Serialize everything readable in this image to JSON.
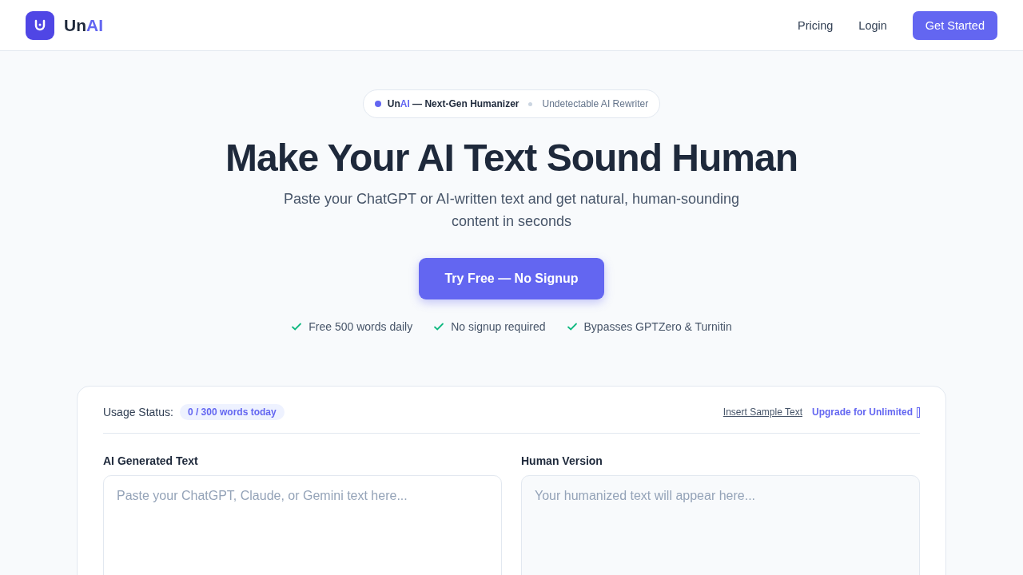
{
  "header": {
    "logo_parts": [
      {
        "text": "Un",
        "accent": false
      },
      {
        "text": "AI",
        "accent": true
      }
    ],
    "nav": [
      {
        "label": "Pricing",
        "kind": "link"
      },
      {
        "label": "Login",
        "kind": "link"
      },
      {
        "label": "Get Started",
        "kind": "primary"
      }
    ]
  },
  "hero": {
    "badge": {
      "title_parts": [
        {
          "text": "Un",
          "accent": false
        },
        {
          "text": "AI",
          "accent": true
        },
        {
          "text": " — Next-Gen Humanizer",
          "accent": false
        }
      ],
      "subtitle": "Undetectable AI Rewriter"
    },
    "title": "Make Your AI Text Sound Human",
    "subtitle": "Paste your ChatGPT or AI-written text and get natural, human-sounding content in seconds",
    "cta": "Try Free — No Signup",
    "features": [
      "Free 500 words daily",
      "No signup required",
      "Bypasses GPTZero & Turnitin"
    ]
  },
  "tool": {
    "usage_label": "Usage Status:",
    "usage_count": "0 / 300 words today",
    "insert_link": "Insert Sample Text",
    "upgrade_link": "Upgrade for Unlimited",
    "panels": [
      {
        "label": "AI Generated Text",
        "placeholder": "Paste your ChatGPT, Claude, or Gemini text here...",
        "kind": "input"
      },
      {
        "label": "Human Version",
        "placeholder": "Your humanized text will appear here...",
        "kind": "output"
      }
    ]
  }
}
